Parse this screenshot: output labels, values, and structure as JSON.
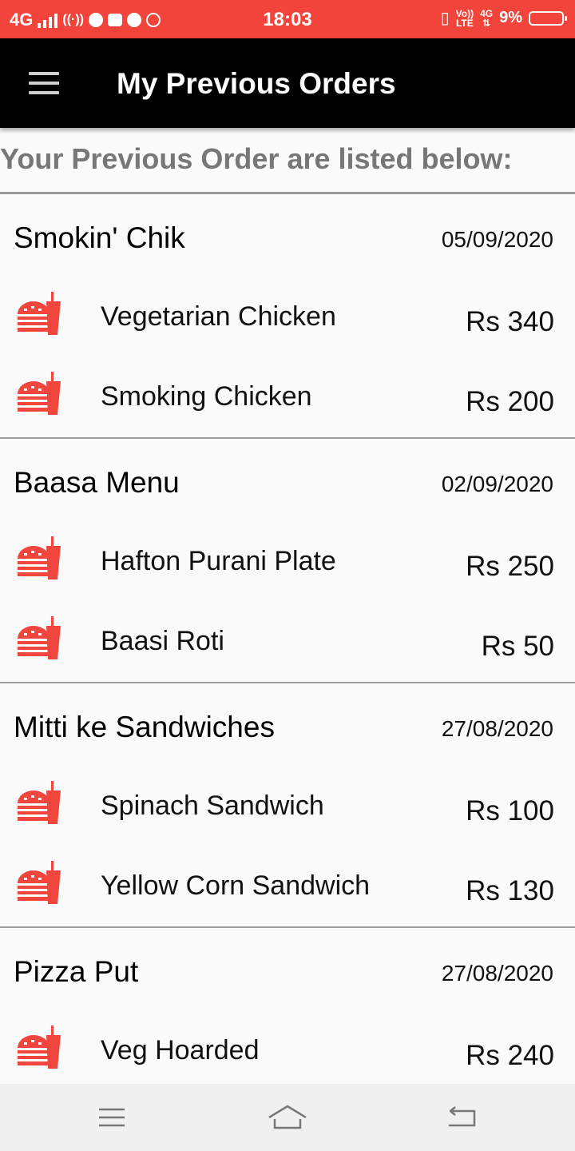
{
  "status_bar": {
    "network": "4G",
    "time": "18:03",
    "volte_top": "Vo))",
    "volte_bottom": "LTE",
    "data_type": "4G",
    "battery": "9%"
  },
  "toolbar": {
    "title": "My Previous Orders",
    "menu_icon": "hamburger-icon"
  },
  "subtitle": "Your Previous Order are listed below:",
  "colors": {
    "status_bar": "#f2443b",
    "toolbar": "#000000",
    "accent_icon": "#f0463d"
  },
  "orders": [
    {
      "restaurant": "Smokin' Chik",
      "date": "05/09/2020",
      "items": [
        {
          "name": "Vegetarian Chicken",
          "price": "Rs 340"
        },
        {
          "name": "Smoking Chicken",
          "price": "Rs 200"
        }
      ]
    },
    {
      "restaurant": "Baasa Menu",
      "date": "02/09/2020",
      "items": [
        {
          "name": "Hafton Purani Plate",
          "price": "Rs 250"
        },
        {
          "name": "Baasi Roti",
          "price": "Rs 50"
        }
      ]
    },
    {
      "restaurant": "Mitti ke Sandwiches",
      "date": "27/08/2020",
      "items": [
        {
          "name": "Spinach Sandwich",
          "price": "Rs 100"
        },
        {
          "name": "Yellow Corn Sandwich",
          "price": "Rs 130"
        }
      ]
    },
    {
      "restaurant": "Pizza Put",
      "date": "27/08/2020",
      "items": [
        {
          "name": "Veg Hoarded",
          "price": "Rs 240"
        }
      ]
    }
  ],
  "nav_bar": {
    "menu": "recents-icon",
    "home": "home-icon",
    "back": "back-icon"
  }
}
